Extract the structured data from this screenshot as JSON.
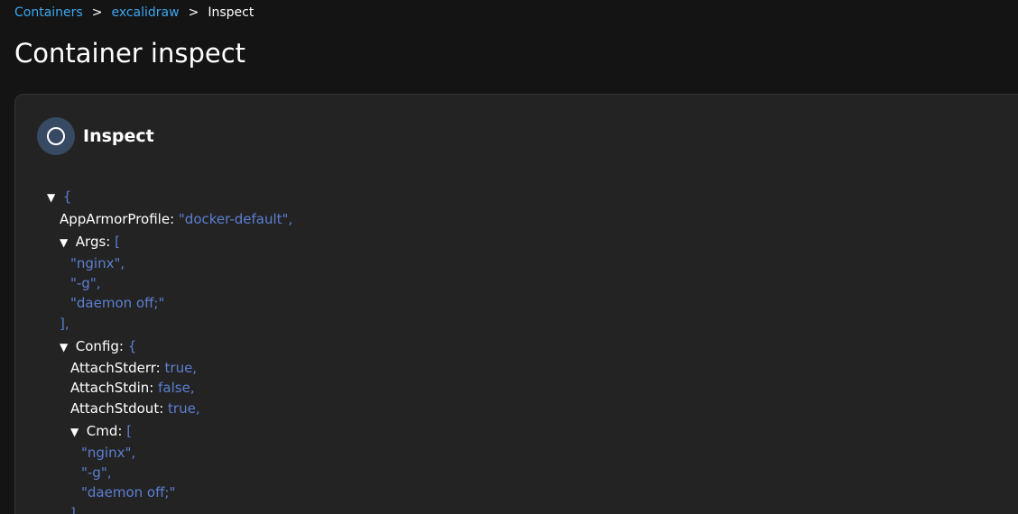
{
  "breadcrumb": {
    "items": [
      "Containers",
      "excalidraw"
    ],
    "current": "Inspect",
    "separator": ">"
  },
  "page_title": "Container inspect",
  "card": {
    "title": "Inspect",
    "icon": "circle-icon"
  },
  "json_tree": {
    "toggle_glyph": "▼",
    "open_brace": "{",
    "rows": {
      "apparmor_key": "AppArmorProfile:",
      "apparmor_val": "\"docker-default\",",
      "args_key": "Args:",
      "args_open": "[",
      "args_0": "\"nginx\",",
      "args_1": "\"-g\",",
      "args_2": "\"daemon off;\"",
      "args_close": "],",
      "config_key": "Config:",
      "config_open": "{",
      "attach_stderr_key": "AttachStderr:",
      "attach_stderr_val": "true,",
      "attach_stdin_key": "AttachStdin:",
      "attach_stdin_val": "false,",
      "attach_stdout_key": "AttachStdout:",
      "attach_stdout_val": "true,",
      "cmd_key": "Cmd:",
      "cmd_open": "[",
      "cmd_0": "\"nginx\",",
      "cmd_1": "\"-g\",",
      "cmd_2": "\"daemon off;\"",
      "cmd_close": "],"
    }
  },
  "colors": {
    "link": "#3ba6ef",
    "json_value": "#5c7fd1",
    "icon_bg": "#384a63",
    "card_bg": "#232323",
    "page_bg": "#141414"
  }
}
